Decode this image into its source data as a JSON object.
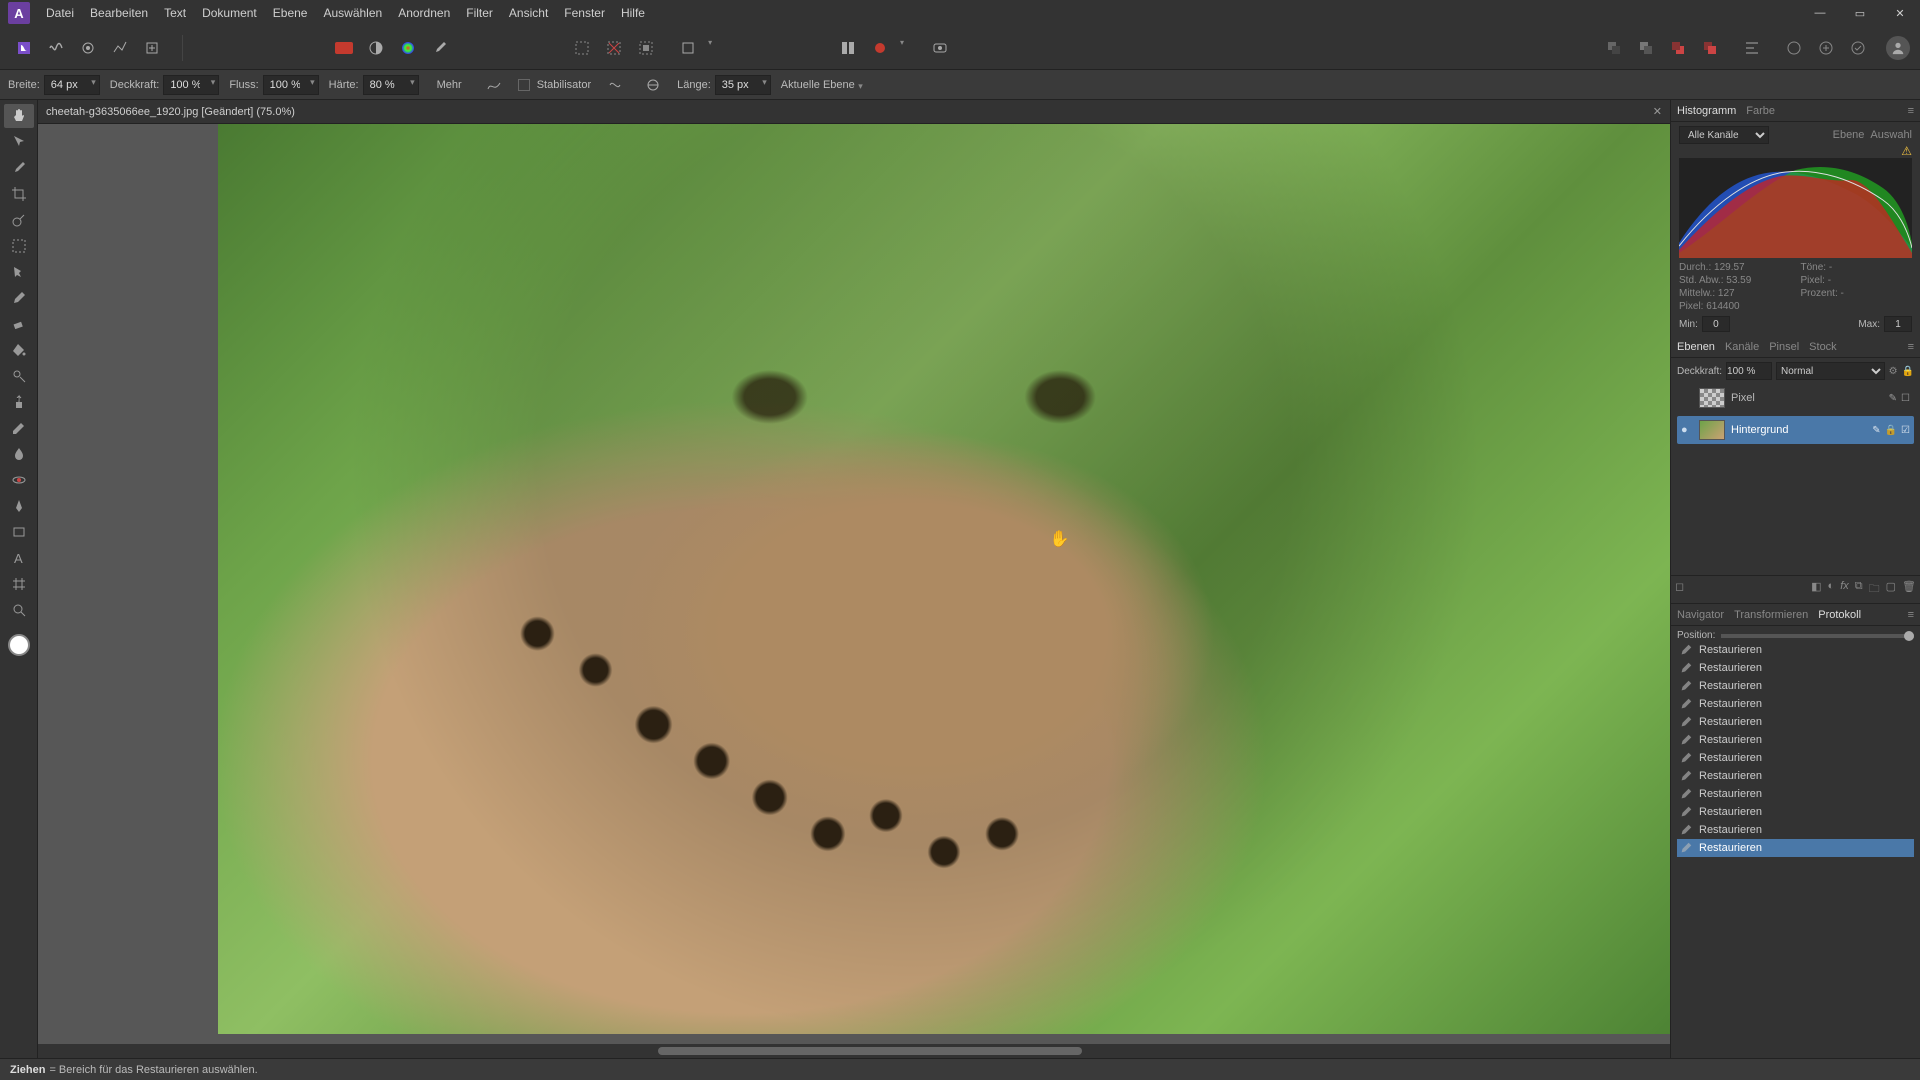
{
  "menu": {
    "items": [
      "Datei",
      "Bearbeiten",
      "Text",
      "Dokument",
      "Ebene",
      "Auswählen",
      "Anordnen",
      "Filter",
      "Ansicht",
      "Fenster",
      "Hilfe"
    ]
  },
  "context": {
    "breite_label": "Breite:",
    "breite_value": "64 px",
    "deckkraft_label": "Deckkraft:",
    "deckkraft_value": "100 %",
    "fluss_label": "Fluss:",
    "fluss_value": "100 %",
    "haerte_label": "Härte:",
    "haerte_value": "80 %",
    "mehr": "Mehr",
    "stabilisator": "Stabilisator",
    "laenge_label": "Länge:",
    "laenge_value": "35 px",
    "aktuelle_ebene": "Aktuelle Ebene"
  },
  "document": {
    "tab_label": "cheetah-g3635066ee_1920.jpg [Geändert] (75.0%)"
  },
  "panels": {
    "histogram": {
      "tabs": [
        "Histogramm",
        "Farbe"
      ],
      "channel": "Alle Kanäle",
      "sub_tabs": [
        "Ebene",
        "Auswahl"
      ],
      "stats": {
        "durch": "Durch.: 129.57",
        "stdabw": "Std. Abw.: 53.59",
        "mittelw": "Mittelw.: 127",
        "pixel": "Pixel: 614400",
        "toene": "Töne: -",
        "pixel2": "Pixel: -",
        "prozent": "Prozent: -"
      },
      "min_label": "Min:",
      "min_value": "0",
      "max_label": "Max:",
      "max_value": "1"
    },
    "layers": {
      "tabs": [
        "Ebenen",
        "Kanäle",
        "Pinsel",
        "Stock"
      ],
      "opacity_label": "Deckkraft:",
      "opacity_value": "100 %",
      "blend_mode": "Normal",
      "rows": [
        {
          "name": "Pixel",
          "selected": false
        },
        {
          "name": "Hintergrund",
          "selected": true
        }
      ]
    },
    "history": {
      "tabs": [
        "Navigator",
        "Transformieren",
        "Protokoll"
      ],
      "position_label": "Position:",
      "items": [
        "Restaurieren",
        "Restaurieren",
        "Restaurieren",
        "Restaurieren",
        "Restaurieren",
        "Restaurieren",
        "Restaurieren",
        "Restaurieren",
        "Restaurieren",
        "Restaurieren",
        "Restaurieren",
        "Restaurieren"
      ]
    }
  },
  "status": {
    "action": "Ziehen",
    "hint": " = Bereich für das Restaurieren auswählen."
  },
  "colors": {
    "accent": "#4a78a8",
    "red_swatch": "#c43a2e"
  }
}
